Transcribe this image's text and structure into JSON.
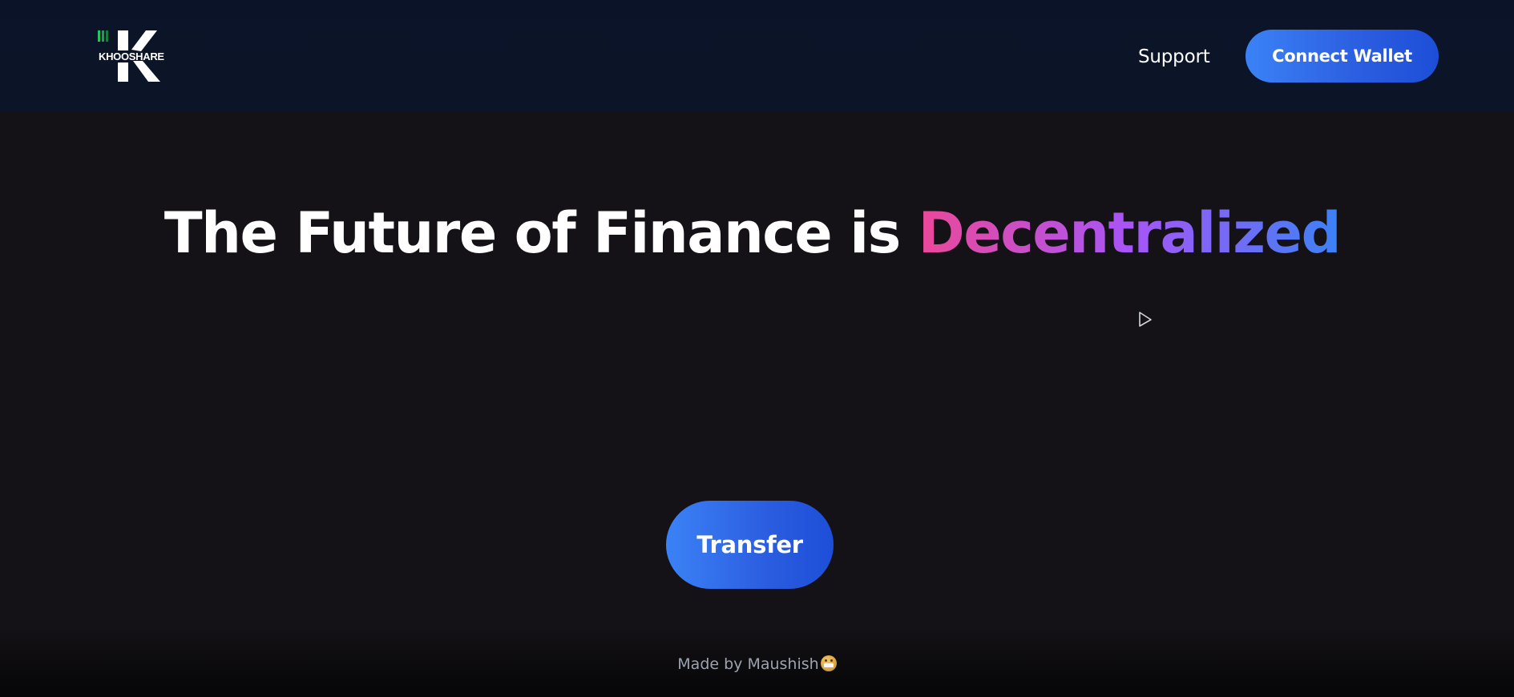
{
  "header": {
    "logo": {
      "text": "KHOOSHARE",
      "letter": "K"
    },
    "nav": {
      "support_label": "Support"
    },
    "connect_wallet_label": "Connect Wallet"
  },
  "hero": {
    "title_main": "The Future of Finance is",
    "title_accent": "Decentralized",
    "transfer_label": "Transfer"
  },
  "footer": {
    "text": "Made by Maushish"
  },
  "colors": {
    "header_bg": "#0b1328",
    "page_bg": "#141216",
    "button_gradient_start": "#3b82f6",
    "button_gradient_end": "#1d4ed8",
    "accent_gradient": [
      "#ec4899",
      "#a855f7",
      "#3b82f6"
    ],
    "logo_bars": "#22c55e"
  },
  "icons": {
    "cursor": "pointer-cursor-icon",
    "footer_emoji": "grinning-face-icon"
  }
}
